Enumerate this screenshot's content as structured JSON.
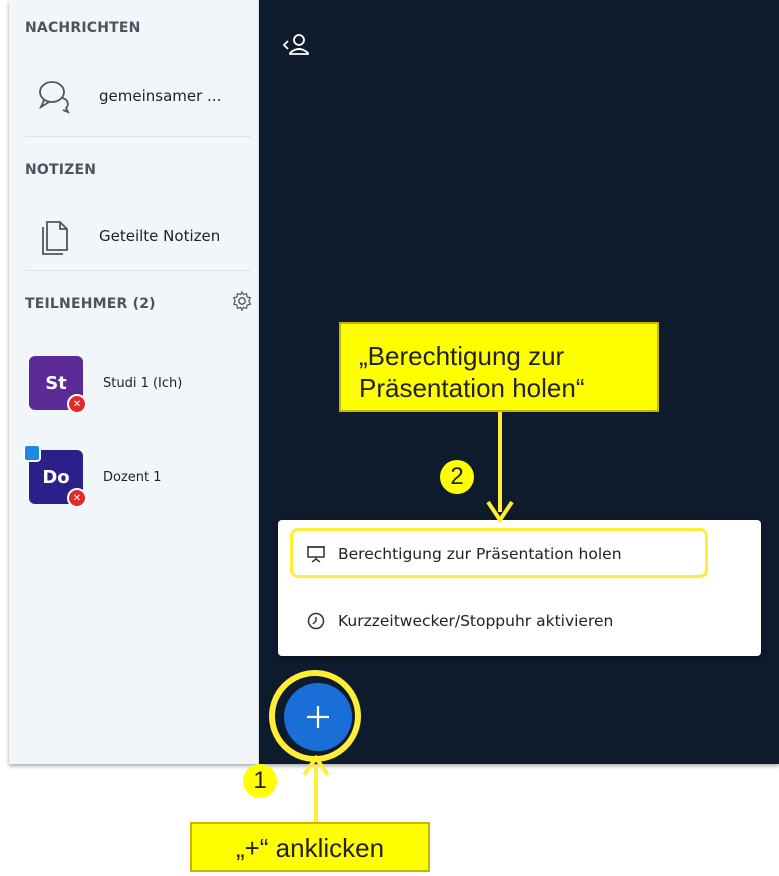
{
  "sidebar": {
    "messages_title": "NACHRICHTEN",
    "messages_item": "gemeinsamer ...",
    "notes_title": "NOTIZEN",
    "notes_item": "Geteilte Notizen",
    "participants_title": "TEILNEHMER (2)",
    "users": [
      {
        "initials": "St",
        "name": "Studi 1 (Ich)",
        "color": "#5b2a96"
      },
      {
        "initials": "Do",
        "name": "Dozent 1",
        "color": "#2d1f8a"
      }
    ]
  },
  "menu": {
    "items": [
      {
        "label": "Berechtigung zur Präsentation holen",
        "icon": "presentation-icon"
      },
      {
        "label": "Kurzzeitwecker/Stoppuhr aktivieren",
        "icon": "clock-icon"
      }
    ]
  },
  "annotations": {
    "callout_top": [
      "„Berechtigung zur",
      "Präsentation holen“"
    ],
    "callout_bottom": "„+“ anklicken",
    "step1": "1",
    "step2": "2"
  },
  "colors": {
    "main_bg": "#0e1b2c",
    "fab": "#1a6ed8",
    "highlight": "#ffee33",
    "callout": "#ffff00",
    "mic_off": "#e22a2a"
  }
}
